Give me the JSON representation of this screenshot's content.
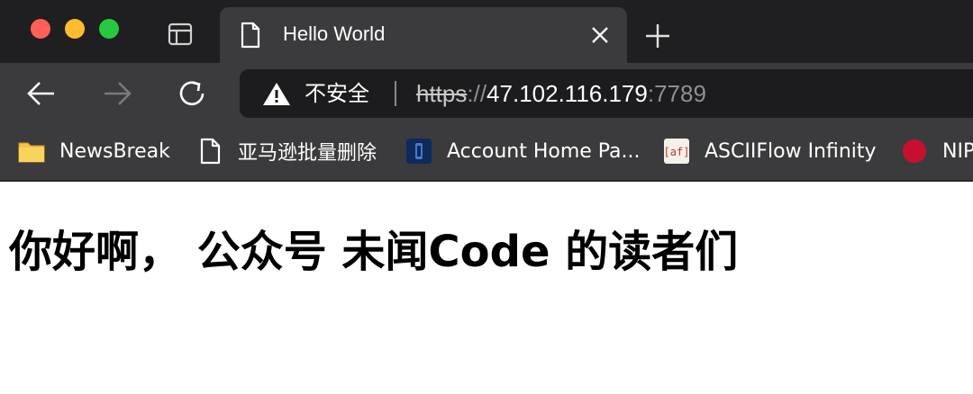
{
  "window": {
    "traffic_lights": {
      "close": "#fe5f57",
      "minimize": "#febc2e",
      "maximize": "#28c840"
    }
  },
  "tab": {
    "title": "Hello World",
    "icon": "document-icon"
  },
  "toolbar": {
    "security_label": "不安全",
    "url": {
      "scheme": "https",
      "slashes": "://",
      "host": "47.102.116.179",
      "port": ":7789"
    }
  },
  "bookmarks": [
    {
      "label": "NewsBreak",
      "icon": "folder-icon"
    },
    {
      "label": "亚马逊批量删除",
      "icon": "document-icon"
    },
    {
      "label": "Account Home Pa...",
      "icon": "bank-icon"
    },
    {
      "label": "ASCIIFlow Infinity",
      "icon": "asciiflow-icon"
    },
    {
      "label": "NIP",
      "icon": "red-circle-icon"
    }
  ],
  "page": {
    "heading": "你好啊，  公众号 未闻Code 的读者们"
  }
}
